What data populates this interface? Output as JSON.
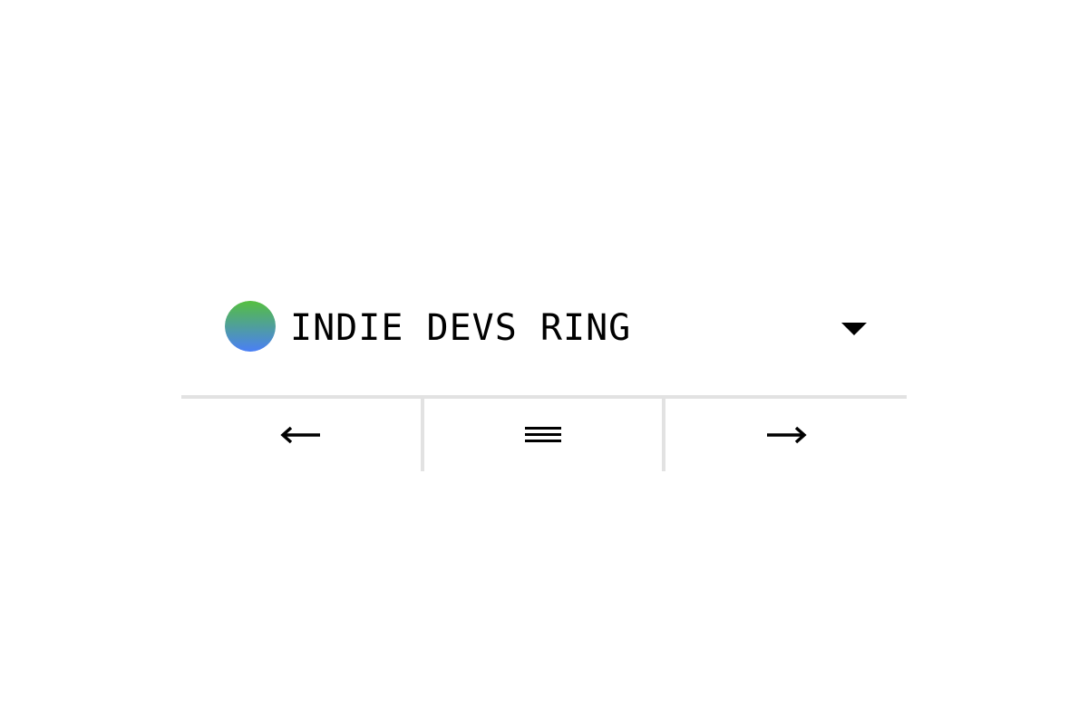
{
  "ring": {
    "name": "INDIE DEVS RING",
    "logo_gradient": {
      "top": "#55bf3f",
      "bottom": "#4a7ff7"
    }
  },
  "icons": {
    "dropdown": "caret-down-icon",
    "previous": "arrow-left-icon",
    "list": "menu-icon",
    "next": "arrow-right-icon"
  },
  "colors": {
    "text": "#000000",
    "divider": "#e2e2e2",
    "background": "#ffffff"
  }
}
